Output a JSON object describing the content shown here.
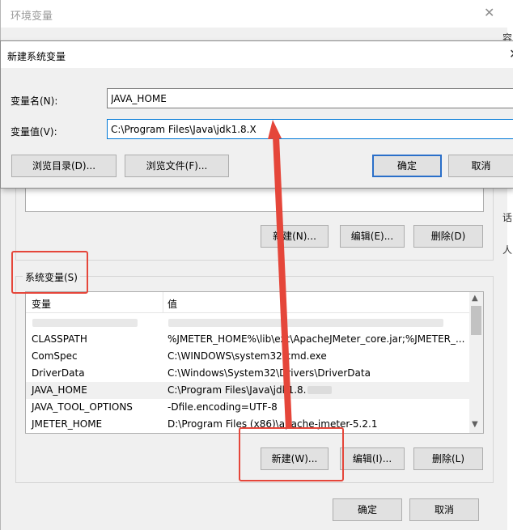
{
  "env_window": {
    "title": "环境变量",
    "close_glyph": "✕",
    "user_buttons": {
      "new": "新建(N)...",
      "edit": "编辑(E)...",
      "delete": "删除(D)"
    },
    "system_group_label": "系统变量(S)",
    "system_table": {
      "col_var": "变量",
      "col_val": "值",
      "rows": [
        {
          "name": "CLASSPATH",
          "value": "%JMETER_HOME%\\lib\\ext\\ApacheJMeter_core.jar;%JMETER_..."
        },
        {
          "name": "ComSpec",
          "value": "C:\\WINDOWS\\system32\\cmd.exe"
        },
        {
          "name": "DriverData",
          "value": "C:\\Windows\\System32\\Drivers\\DriverData"
        },
        {
          "name": "JAVA_HOME",
          "value": "C:\\Program Files\\Java\\jdk1.8."
        },
        {
          "name": "JAVA_TOOL_OPTIONS",
          "value": "-Dfile.encoding=UTF-8"
        },
        {
          "name": "JMETER_HOME",
          "value": "D:\\Program Files (x86)\\apache-jmeter-5.2.1"
        }
      ]
    },
    "system_buttons": {
      "new": "新建(W)...",
      "edit": "编辑(I)...",
      "delete": "删除(L)"
    },
    "footer_buttons": {
      "ok": "确定",
      "cancel": "取消"
    },
    "edge_fragments": {
      "a": "容",
      "b": "话",
      "c": "人"
    }
  },
  "new_var_dialog": {
    "title": "新建系统变量",
    "close_glyph": "✕",
    "name_label": "变量名(N):",
    "name_value": "JAVA_HOME",
    "value_label": "变量值(V):",
    "value_value": "C:\\Program Files\\Java\\jdk1.8.X",
    "browse_dir": "浏览目录(D)...",
    "browse_file": "浏览文件(F)...",
    "ok": "确定",
    "cancel": "取消"
  },
  "annotation_color": "#e5463a"
}
